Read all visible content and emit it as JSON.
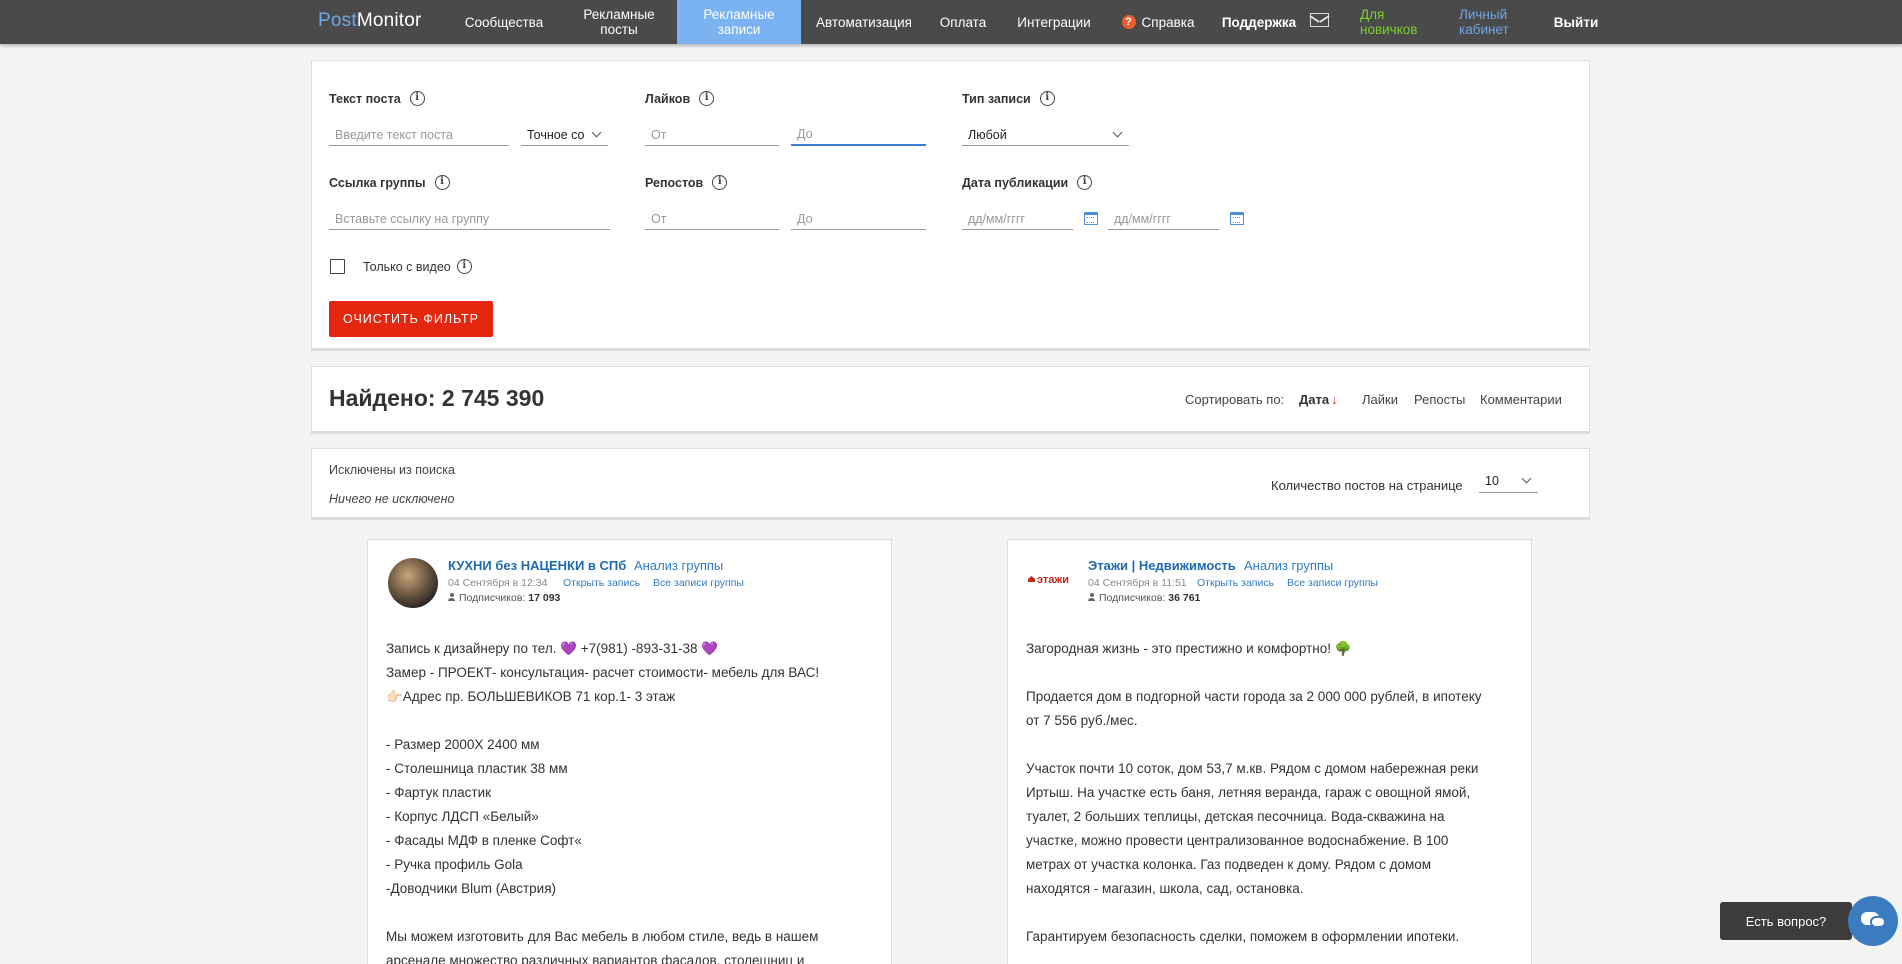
{
  "nav": {
    "logo_part1": "Post",
    "logo_part2": "Monitor",
    "items": [
      {
        "label": "Сообщества"
      },
      {
        "label": "Рекламные\nпосты"
      },
      {
        "label": "Рекламные\nзаписи",
        "active": true
      },
      {
        "label": "Автоматизация"
      },
      {
        "label": "Оплата"
      },
      {
        "label": "Интеграции"
      },
      {
        "label": "Справка"
      },
      {
        "label": "Поддержка"
      },
      {
        "label": "Для\nновичков",
        "color": "#7dcf2d"
      },
      {
        "label": "Личный\nкабинет",
        "color": "#6fa6e8"
      },
      {
        "label": "Выйти"
      }
    ],
    "help_icon": "?"
  },
  "filter": {
    "post_text_label": "Текст поста",
    "post_text_placeholder": "Введите текст поста",
    "match_mode": "Точное со",
    "likes_label": "Лайков",
    "from_placeholder": "От",
    "to_placeholder": "До",
    "post_type_label": "Тип записи",
    "post_type_value": "Любой",
    "group_link_label": "Ссылка группы",
    "group_link_placeholder": "Вставьте ссылку на группу",
    "reposts_label": "Репостов",
    "pub_date_label": "Дата публикации",
    "date_placeholder": "дд/мм/гггг",
    "video_only_label": "Только с видео",
    "clear_button": "ОЧИСТИТЬ ФИЛЬТР",
    "info_icon": "i"
  },
  "results": {
    "found": "Найдено: 2 745 390",
    "sort_label": "Сортировать по:",
    "sort_items": [
      "Дата",
      "Лайки",
      "Репосты",
      "Комментарии"
    ],
    "sort_arrow": "↓"
  },
  "exclusions": {
    "title": "Исключены из поиска",
    "value": "Ничего не исключено",
    "per_page_label": "Количество постов на странице",
    "per_page_value": "10"
  },
  "cards": [
    {
      "group_name": "КУХНИ без НАЦЕНКИ в СПб",
      "analysis_link": "Анализ группы",
      "date": "04 Сентября в 12:34",
      "open_link": "Открыть запись",
      "all_link": "Все записи группы",
      "subscribers_label": "Подписчиков:",
      "subscribers": "17 093",
      "lines": [
        "Запись к дизайнеру по тел. 💜 +7(981) -893-31-38 💜",
        "Замер - ПРОЕКТ- консультация- расчет стоимости- мебель для ВАС!",
        "👉🏻Адрес пр. БОЛЬШЕВИКОВ 71 кор.1- 3 этаж",
        "",
        "- Размер 2000Х 2400 мм",
        "- Столешница пластик 38 мм",
        "- Фартук пластик",
        "- Корпус ЛДСП «Белый»",
        "- Фасады МДФ в пленке Софт«",
        "- Ручка профиль Gola",
        "-Доводчики Blum (Австрия)",
        "",
        "Мы можем изготовить для Вас мебель в любом стиле, ведь в нашем",
        "арсенале множество различных вариантов фасадов, столешниц и"
      ]
    },
    {
      "logo_text": "этажи",
      "group_name": "Этажи | Недвижимость",
      "analysis_link": "Анализ группы",
      "date": "04 Сентября в 11:51",
      "open_link": "Открыть запись",
      "all_link": "Все записи группы",
      "subscribers_label": "Подписчиков:",
      "subscribers": "36 761",
      "lines": [
        "Загородная жизнь - это престижно и комфортно! 🌳",
        "",
        "Продается дом в подгорной части города за 2 000 000 рублей, в ипотеку",
        "от 7 556 руб./мес.",
        "",
        "Участок почти 10 соток, дом 53,7 м.кв. Рядом с домом набережная реки",
        "Иртыш. На участке есть баня, летняя веранда, гараж с овощной ямой,",
        "туалет, 2 больших теплицы, детская песочница. Вода-скважина на",
        "участке, можно провести централизованное водоснабжение. В 100",
        "метрах от участка колонка. Газ подведен к дому. Рядом с домом",
        "находятся - магазин, школа, сад, остановка.",
        "",
        "Гарантируем безопасность сделки, поможем в оформлении ипотеки."
      ]
    }
  ],
  "chat": {
    "bubble": "Есть вопрос?",
    "icon": "chat-icon"
  }
}
